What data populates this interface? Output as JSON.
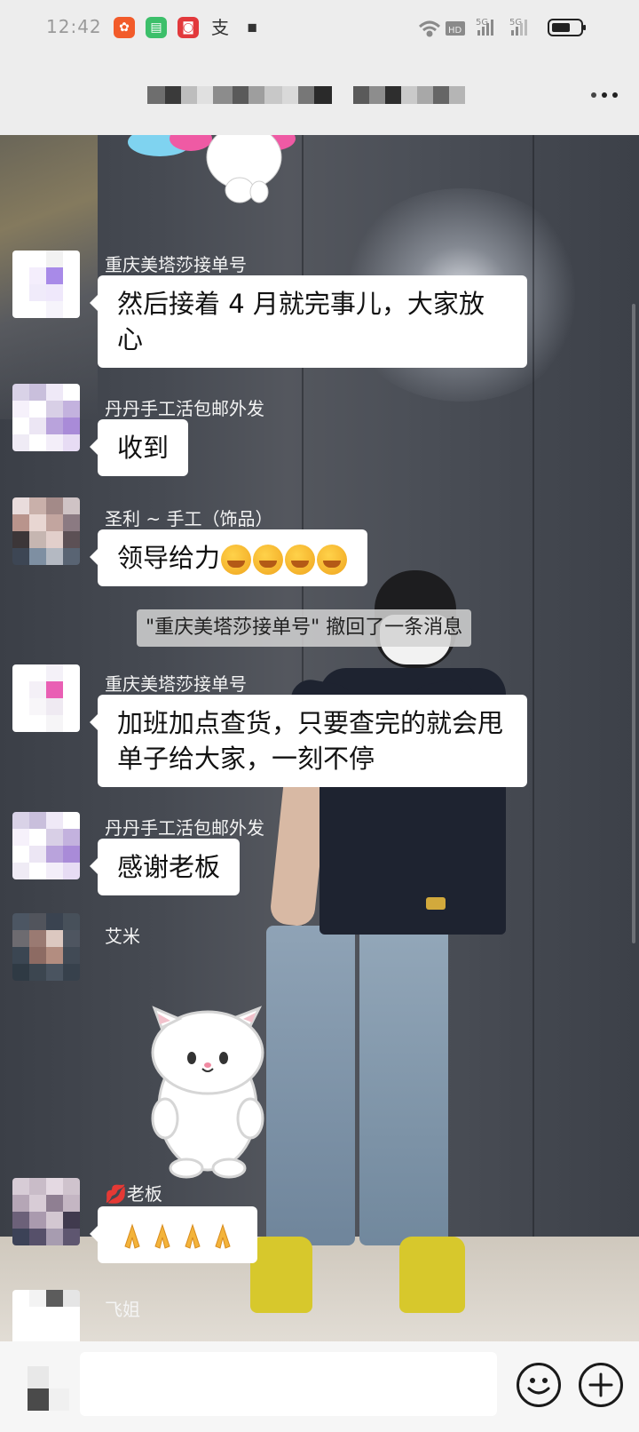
{
  "status_bar": {
    "time": "12:42",
    "apps": [
      {
        "icon": "app-icon-orange",
        "color": "#f25b2a",
        "glyph": "✿"
      },
      {
        "icon": "wechat-icon",
        "color": "#3cbf6a",
        "glyph": "▤"
      },
      {
        "icon": "app-icon-red",
        "color": "#e2393c",
        "glyph": "◙"
      },
      {
        "icon": "alipay-icon",
        "color": "#ededed",
        "glyph": "支"
      },
      {
        "icon": "app-icon-dark",
        "color": "#ededed",
        "glyph": "◼"
      }
    ],
    "network": "5G",
    "network2": "5G"
  },
  "header": {
    "title": "",
    "more_icon": "more-icon"
  },
  "messages": [
    {
      "sender": "重庆美塔莎接单号",
      "text": "然后接着 4 月就完事儿，大家放心",
      "avatar": [
        "#ffffff",
        "#ffffff",
        "#f2f2f2",
        "#ffffff",
        "#ffffff",
        "#f4eefc",
        "#a88ae8",
        "#ffffff",
        "#ffffff",
        "#f0ebfa",
        "#efe8fb",
        "#ffffff",
        "#ffffff",
        "#ffffff",
        "#f6f4fb",
        "#ffffff"
      ]
    },
    {
      "sender": "丹丹手工活包邮外发",
      "text": "收到",
      "avatar": [
        "#d9d2e7",
        "#c9bfdc",
        "#efe9f7",
        "#ffffff",
        "#f6f1fb",
        "#ffffff",
        "#d8cfe6",
        "#c3b2de",
        "#ffffff",
        "#ece6f4",
        "#b9a3dc",
        "#a98bd8",
        "#efebf5",
        "#ffffff",
        "#f3eef9",
        "#e7dcf4"
      ]
    },
    {
      "sender": "圣利 ~ 手工（饰品）",
      "text": "领导给力",
      "emojis": 4,
      "avatar": [
        "#e9dcdc",
        "#c9b0aa",
        "#a38a88",
        "#cfc3c5",
        "#b9948c",
        "#e8d6d2",
        "#c2a59f",
        "#8b7a82",
        "#3c3638",
        "#c6b6b1",
        "#e2cfcb",
        "#5c5055",
        "#3d4654",
        "#7e8fa2",
        "#b4b9c2",
        "#596473"
      ]
    },
    {
      "sender": "重庆美塔莎接单号",
      "text": "加班加点查货，只要查完的就会甩单子给大家，一刻不停",
      "avatar": [
        "#ffffff",
        "#ffffff",
        "#f4f1f8",
        "#ffffff",
        "#ffffff",
        "#f4f0f7",
        "#e95fb4",
        "#ffffff",
        "#ffffff",
        "#f8f6f9",
        "#efeaf2",
        "#ffffff",
        "#ffffff",
        "#ffffff",
        "#f6f5f7",
        "#ffffff"
      ]
    },
    {
      "sender": "丹丹手工活包邮外发",
      "text": "感谢老板",
      "avatar": [
        "#d9d2e7",
        "#c9bfdc",
        "#efe9f7",
        "#ffffff",
        "#f6f1fb",
        "#ffffff",
        "#d8cfe6",
        "#c3b2de",
        "#ffffff",
        "#ece6f4",
        "#b9a3dc",
        "#a98bd8",
        "#efebf5",
        "#ffffff",
        "#f3eef9",
        "#e7dcf4"
      ]
    },
    {
      "sender": "艾米",
      "text": "",
      "avatar": [
        "#4c5663",
        "#51545c",
        "#3a4350",
        "#47505a",
        "#6d6b70",
        "#9a7a72",
        "#dcc8c0",
        "#4e5560",
        "#3b4652",
        "#8d6b63",
        "#b38d80",
        "#414a55",
        "#2f3a44",
        "#3c4650",
        "#4a5460",
        "#37414c"
      ]
    },
    {
      "sender": "老板",
      "text": "",
      "emojis": 4,
      "avatar": [
        "#d7ccd6",
        "#c9bcc8",
        "#e4d9e2",
        "#cfc3cd",
        "#b5a6b6",
        "#d8ccd6",
        "#8f7f92",
        "#c4b6c3",
        "#6c6179",
        "#aa9aae",
        "#d3c7d1",
        "#403a4e",
        "#3c4257",
        "#56506a",
        "#a79cb0",
        "#5e5670"
      ]
    },
    {
      "sender": "飞姐",
      "text": "",
      "avatar": [
        "#ffffff",
        "#f3f3f3",
        "#5c5c5c",
        "#e5e5e5",
        "#ffffff",
        "#ffffff",
        "#ffffff",
        "#ffffff",
        "#ffffff",
        "#ffffff",
        "#ffffff",
        "#ffffff",
        "#ffffff",
        "#ffffff",
        "#ffffff",
        "#ffffff"
      ]
    }
  ],
  "system_message": "\"重庆美塔莎接单号\" 撤回了一条消息",
  "input_bar": {
    "placeholder": "",
    "emoji_icon": "emoji-icon",
    "plus_icon": "plus-icon"
  }
}
